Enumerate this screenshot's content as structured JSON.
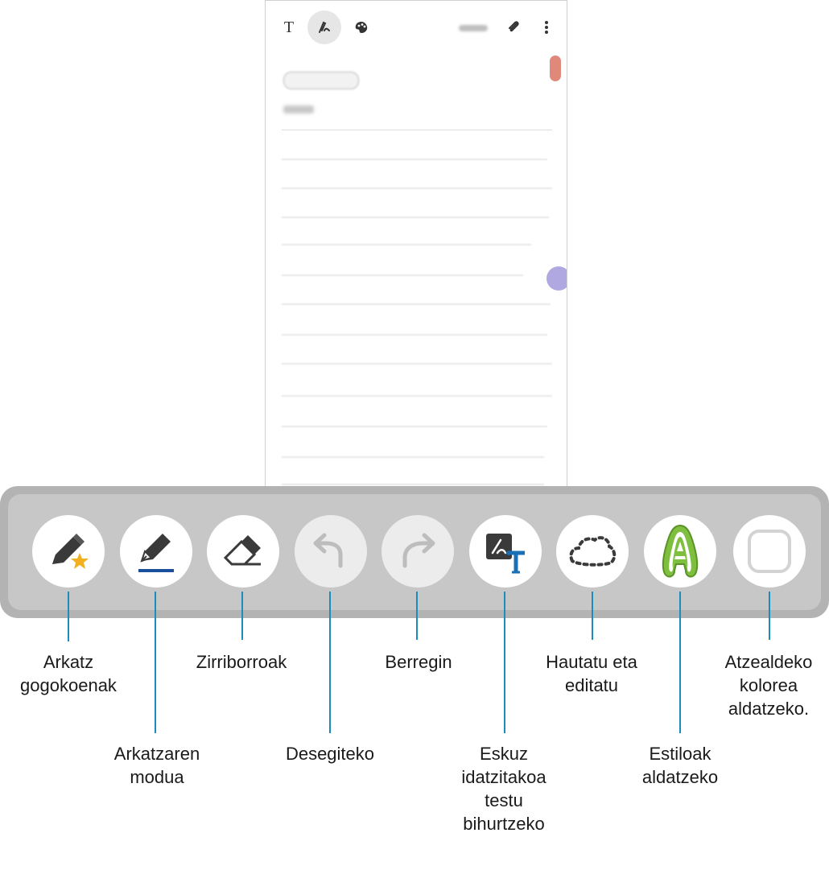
{
  "phone": {
    "text_tool_glyph": "T",
    "pen_tool_icon": "pen-mode-icon",
    "palette_tool_icon": "palette-icon",
    "attach_icon": "paperclip-icon",
    "more_icon": "more-vertical-icon"
  },
  "toolbar": {
    "tools": [
      {
        "name": "favorite-pens",
        "icon": "pen-star-icon"
      },
      {
        "name": "pen-mode",
        "icon": "fountain-pen-icon"
      },
      {
        "name": "eraser",
        "icon": "eraser-icon"
      },
      {
        "name": "undo",
        "icon": "undo-arrow-icon"
      },
      {
        "name": "redo",
        "icon": "redo-arrow-icon"
      },
      {
        "name": "handwriting-to-text",
        "icon": "handwriting-to-text-icon"
      },
      {
        "name": "select-edit",
        "icon": "lasso-select-icon"
      },
      {
        "name": "styles",
        "icon": "outline-a-icon"
      },
      {
        "name": "background-color",
        "icon": "rounded-square-icon"
      }
    ]
  },
  "labels": {
    "favorite_pens": "Arkatz\ngogokoenak",
    "pen_mode": "Arkatzaren\nmodua",
    "eraser": "Zirriborroak",
    "undo": "Desegiteko",
    "redo": "Berregin",
    "handwriting": "Eskuz\nidatzitakoa\ntestu\nbihurtzeko",
    "select_edit": "Hautatu eta\neditatu",
    "styles": "Estiloak\naldatzeko",
    "background": "Atzealdeko\nkolorea\naldatzeko."
  },
  "colors": {
    "callout": "#1b8cbf",
    "toolbar": "#c7c7c7",
    "styles_green": "#6fa83a",
    "pen_blue": "#1a4f9c"
  }
}
